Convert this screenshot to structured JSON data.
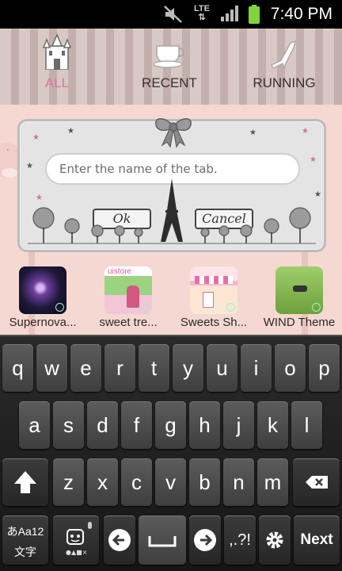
{
  "status_bar": {
    "network": "LTE",
    "time": "7:40 PM"
  },
  "tabs": [
    {
      "label": "ALL",
      "icon": "castle-icon",
      "active": true
    },
    {
      "label": "RECENT",
      "icon": "teacup-icon",
      "active": false
    },
    {
      "label": "RUNNING",
      "icon": "high-heel-icon",
      "active": false
    }
  ],
  "dialog": {
    "placeholder": "Enter the name of the tab.",
    "ok_label": "Ok",
    "cancel_label": "Cancel"
  },
  "apps": [
    {
      "label": "Supernova...",
      "icon": "supernova-icon"
    },
    {
      "label": "sweet tre...",
      "icon": "sweet-tree-icon",
      "badge": "uistore"
    },
    {
      "label": "Sweets Sh...",
      "icon": "sweets-shop-icon"
    },
    {
      "label": "WIND Theme",
      "icon": "wind-theme-icon"
    }
  ],
  "keyboard": {
    "row1": [
      "q",
      "w",
      "e",
      "r",
      "t",
      "y",
      "u",
      "i",
      "o",
      "p"
    ],
    "row2": [
      "a",
      "s",
      "d",
      "f",
      "g",
      "h",
      "j",
      "k",
      "l"
    ],
    "row3": [
      "z",
      "x",
      "c",
      "v",
      "b",
      "n",
      "m"
    ],
    "ime_label_top": "あAa12",
    "ime_label_bottom": "文字",
    "symbols_label": ",.?!",
    "next_label": "Next",
    "colors": {
      "key": "#4d4d4d",
      "background": "#1f1f1f",
      "accent_pink": "#e46fa6"
    }
  }
}
